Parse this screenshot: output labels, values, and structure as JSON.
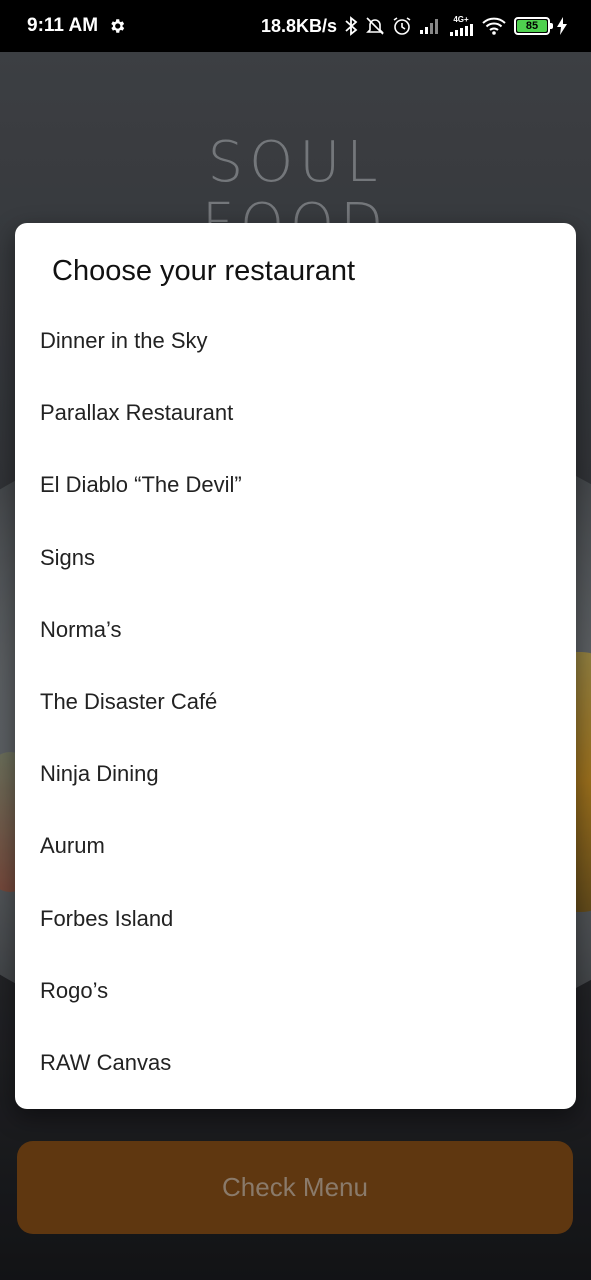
{
  "status_bar": {
    "time": "9:11 AM",
    "net_speed": "18.8KB/s",
    "network_label": "4G+",
    "battery_level": "85",
    "icons": [
      "settings-icon",
      "bluetooth-icon",
      "bell-off-icon",
      "alarm-icon",
      "signal-icon",
      "signal-4g-icon",
      "wifi-icon",
      "battery-icon",
      "charging-icon"
    ]
  },
  "background": {
    "logo_line1": "SOUL",
    "logo_line2": "FOOD"
  },
  "dialog": {
    "title": "Choose your restaurant",
    "options": [
      "Dinner in the Sky",
      "Parallax Restaurant",
      "El Diablo “The Devil”",
      "Signs",
      "Norma’s",
      "The Disaster Café",
      "Ninja Dining",
      "Aurum",
      "Forbes Island",
      "Rogo’s",
      "RAW Canvas"
    ]
  },
  "footer": {
    "check_menu_label": "Check Menu"
  },
  "colors": {
    "button_bg": "#5f3710",
    "button_text": "#8a7a6a",
    "dialog_bg": "#ffffff",
    "battery_fill": "#4fd14f"
  }
}
